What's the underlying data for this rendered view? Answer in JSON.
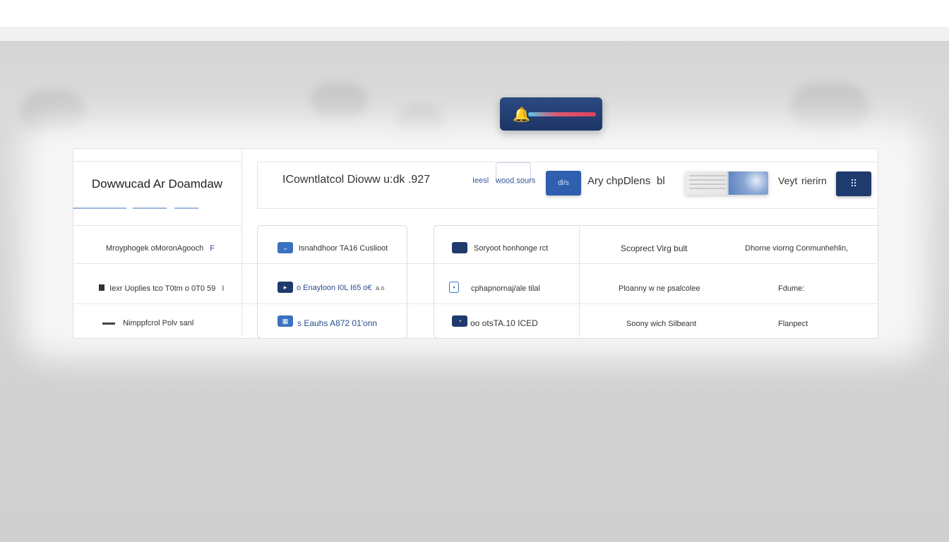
{
  "header": {
    "left_title": "Dowwucad Ar Doamdaw",
    "main_title": "ICowntlatcol Dioww u:dk .927",
    "small_label_1": "Ieesl",
    "small_label_2": "wood sours",
    "pill_button": "dl/s",
    "text_right_1": "Ary chpDlens",
    "text_right_2": "bl",
    "text_right_3": "Veyt",
    "text_right_4": "rierirn",
    "square_button_icon": "⠿"
  },
  "col1": {
    "rows": [
      {
        "label": "Mroyphogek oMoronAgooch",
        "icon_glyph": "F"
      },
      {
        "label": "Iexr Uoplies tco T0tm o 0T0 59",
        "marker": "I"
      },
      {
        "label": "Nimppfcrol Polv sanl"
      }
    ]
  },
  "col2": {
    "rows": [
      {
        "label": "Isnahdhoor TA16 Cuslioot",
        "icon": "chevron-icon"
      },
      {
        "label": "o Enayloon I0L I65 o€",
        "suffix": "a.o",
        "icon": "play-icon"
      },
      {
        "label": "s Eauhs A872 01'onn",
        "icon": "image-icon"
      }
    ]
  },
  "col3": {
    "rows": [
      {
        "label": "Soryoot honhonge rct",
        "icon": "card-icon"
      },
      {
        "label": "cphapnornaj/ale tilal",
        "icon": "doc-icon"
      },
      {
        "label": "oo otsTA.10 ICED",
        "icon": "clock-icon"
      }
    ]
  },
  "col4": {
    "rows": [
      {
        "label": "Scoprect Virg bult"
      },
      {
        "label": "Ploanny w ne psalcolee"
      },
      {
        "label": "Soony wich Silbeant"
      }
    ]
  },
  "col5": {
    "rows": [
      {
        "label": "Dhorne viorng Conmunhehlin,"
      },
      {
        "label": "Fdume:"
      },
      {
        "label": "Flanpect"
      }
    ]
  },
  "colors": {
    "navy": "#1f3a6d",
    "blue": "#2f5fae",
    "accent_red": "#e0405a",
    "accent_cyan": "#55c8e6",
    "bell": "#f3b12e"
  }
}
